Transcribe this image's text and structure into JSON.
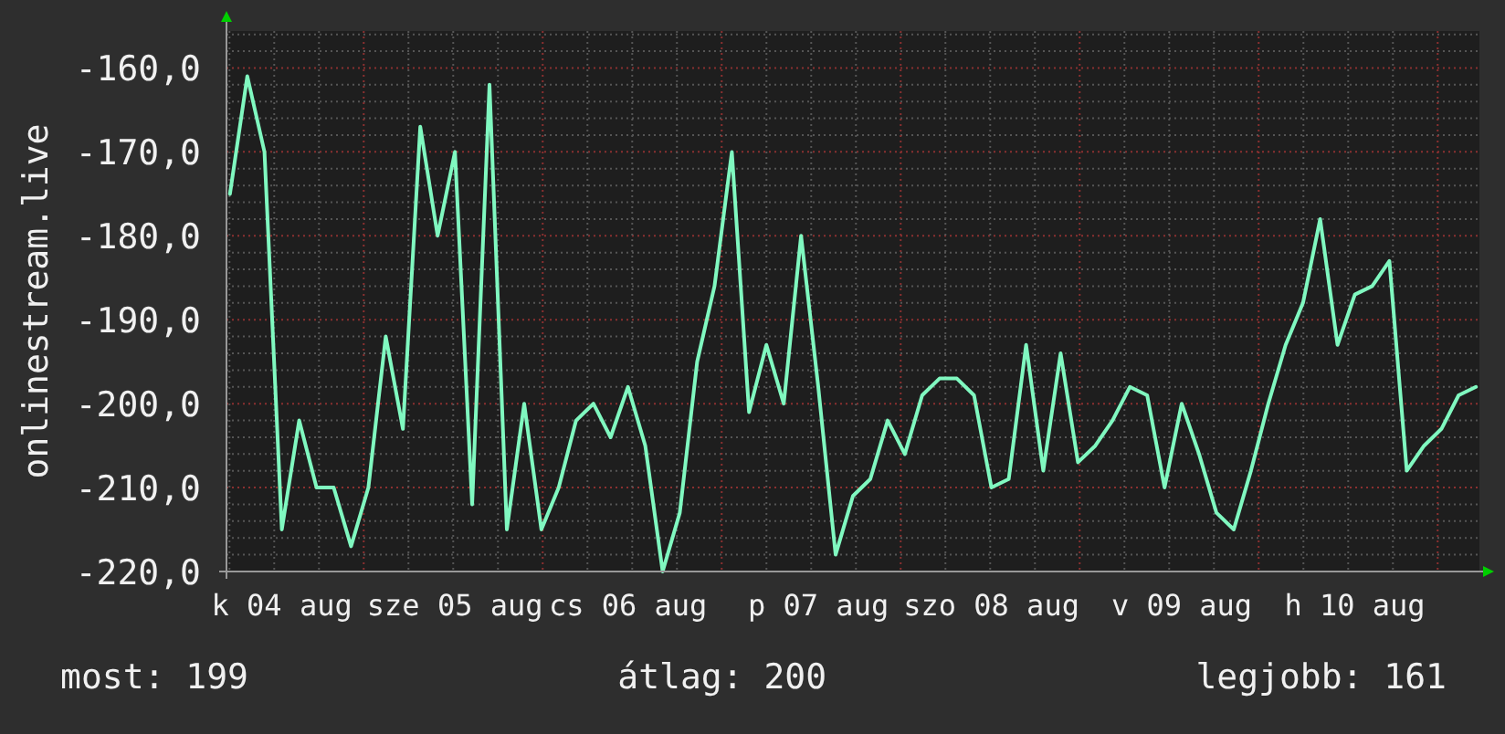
{
  "graph": {
    "chart_data": {
      "type": "line",
      "ylabel": "onlinestream.live",
      "grid": true,
      "ylim": [
        -220,
        -155.6
      ],
      "yticks": [
        {
          "value": -160,
          "label": "-160,0"
        },
        {
          "value": -170,
          "label": "-170,0"
        },
        {
          "value": -180,
          "label": "-180,0"
        },
        {
          "value": -190,
          "label": "-190,0"
        },
        {
          "value": -200,
          "label": "-200,0"
        },
        {
          "value": -210,
          "label": "-210,0"
        },
        {
          "value": -220,
          "label": "-220,0"
        }
      ],
      "categories": [
        null,
        null,
        null,
        "k 04 aug",
        null,
        null,
        null,
        null,
        null,
        null,
        null,
        null,
        null,
        "sze 05 aug",
        null,
        null,
        null,
        null,
        null,
        null,
        null,
        null,
        null,
        "cs 06 aug",
        null,
        null,
        null,
        null,
        null,
        null,
        null,
        null,
        null,
        null,
        "p 07 aug",
        null,
        null,
        null,
        null,
        null,
        null,
        null,
        null,
        null,
        "szo 08 aug",
        null,
        null,
        null,
        null,
        null,
        null,
        null,
        null,
        null,
        null,
        "v 09 aug",
        null,
        null,
        null,
        null,
        null,
        null,
        null,
        null,
        null,
        "h 10 aug",
        null,
        null,
        null,
        null,
        null,
        null,
        null
      ],
      "series": [
        {
          "color": "#80f8c0",
          "values": [
            -175,
            -161,
            -170,
            -215,
            -202,
            -210,
            -210,
            -217,
            -210,
            -192,
            -203,
            -167,
            -180,
            -170,
            -212,
            -162,
            -215,
            -200,
            -215,
            -210,
            -202,
            -200,
            -204,
            -198,
            -205,
            -220,
            -213,
            -195,
            -186,
            -170,
            -201,
            -193,
            -200,
            -180,
            -198,
            -218,
            -211,
            -209,
            -202,
            -206,
            -199,
            -197,
            -197,
            -199,
            -210,
            -209,
            -193,
            -208,
            -194,
            -207,
            -205,
            -202,
            -198,
            -199,
            -210,
            -200,
            -206,
            -213,
            -215,
            -208,
            -200,
            -193,
            -188,
            -178,
            -193,
            -187,
            -186,
            -183,
            -208,
            -205,
            -203,
            -199,
            -198
          ]
        }
      ]
    }
  },
  "summary": [
    {
      "label": "most: 199"
    },
    {
      "label": "átlag: 200"
    },
    {
      "label": "legjobb: 161"
    }
  ]
}
